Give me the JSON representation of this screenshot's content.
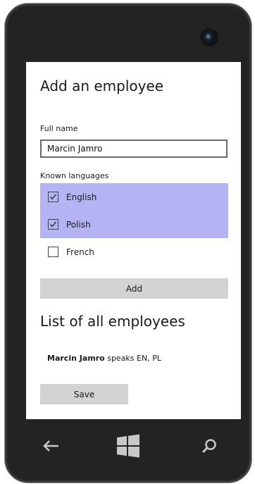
{
  "page": {
    "title": "Add an employee",
    "full_name_label": "Full name",
    "full_name_value": "Marcin Jamro",
    "languages_label": "Known languages",
    "languages": [
      {
        "label": "English",
        "checked": true,
        "selected": true
      },
      {
        "label": "Polish",
        "checked": true,
        "selected": true
      },
      {
        "label": "French",
        "checked": false,
        "selected": false
      }
    ],
    "add_label": "Add",
    "list_title": "List of all employees",
    "employees": [
      {
        "name": "Marcin Jamro",
        "rest": " speaks EN, PL"
      }
    ],
    "save_label": "Save"
  },
  "hardware": {
    "back_icon": "back-arrow-icon",
    "start_icon": "windows-logo-icon",
    "search_icon": "search-icon"
  },
  "colors": {
    "selection": "#b4b4f4",
    "button": "#d3d3d3",
    "phone_body": "#232323"
  }
}
